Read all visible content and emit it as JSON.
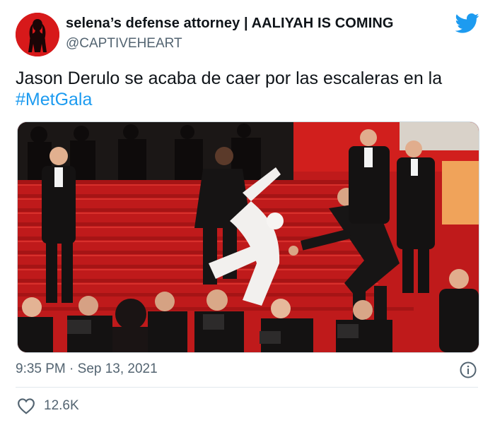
{
  "author": {
    "display_name": "selena’s defense attorney | AALIYAH IS COMING",
    "handle": "@CAPTIVEHEART",
    "avatar_icon": "silhouette-avatar-icon"
  },
  "tweet": {
    "text_prefix": "Jason Derulo se acaba de caer por las escaleras en la",
    "hashtag": "#MetGala"
  },
  "media": {
    "scene": "red-carpet-staircase-photo"
  },
  "meta": {
    "timestamp": "9:35 PM · Sep 13, 2021"
  },
  "engagement": {
    "likes": "12.6K"
  },
  "colors": {
    "brand_blue": "#1d9bf0",
    "secondary_text": "#536471",
    "carpet_red": "#c4191a",
    "avatar_red": "#d7191a"
  },
  "icons": {
    "brand": "twitter-bird-icon",
    "info": "info-icon",
    "like": "heart-icon"
  }
}
